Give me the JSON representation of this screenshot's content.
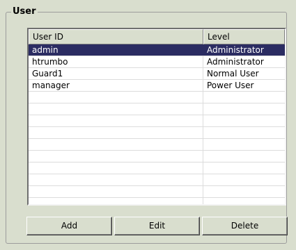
{
  "group": {
    "title": "User"
  },
  "table": {
    "columns": [
      "User ID",
      "Level"
    ],
    "rows": [
      {
        "user_id": "admin",
        "level": "Administrator",
        "selected": true
      },
      {
        "user_id": "htrumbo",
        "level": "Administrator"
      },
      {
        "user_id": "Guard1",
        "level": "Normal User"
      },
      {
        "user_id": "manager",
        "level": "Power User"
      }
    ],
    "empty_rows": 11
  },
  "buttons": {
    "add": "Add",
    "edit": "Edit",
    "delete": "Delete"
  }
}
